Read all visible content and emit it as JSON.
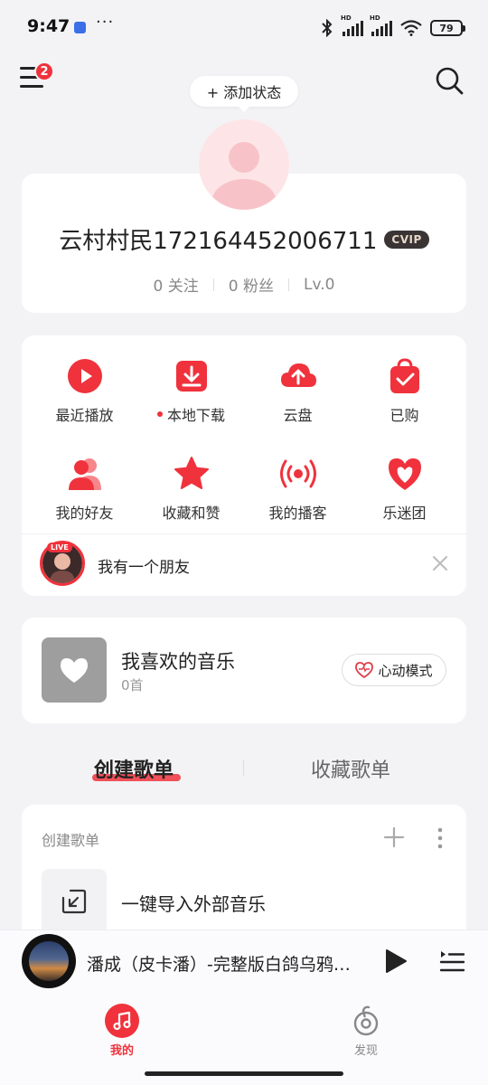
{
  "status_bar": {
    "time": "9:47",
    "more_indicator": "···",
    "battery": "79",
    "hd_label": "HD"
  },
  "header": {
    "menu_badge": "2",
    "add_status_label": "+ 添加状态"
  },
  "profile": {
    "username": "云村村民172164452006711",
    "vip_label": "CVIP",
    "stats": [
      {
        "value": "0",
        "label": "关注"
      },
      {
        "value": "0",
        "label": "粉丝"
      },
      {
        "value": "Lv.0",
        "label": ""
      }
    ]
  },
  "quick_grid": [
    {
      "label": "最近播放",
      "icon": "play-circle-icon",
      "dot": false
    },
    {
      "label": "本地下载",
      "icon": "download-icon",
      "dot": true
    },
    {
      "label": "云盘",
      "icon": "cloud-upload-icon",
      "dot": false
    },
    {
      "label": "已购",
      "icon": "shopping-bag-icon",
      "dot": false
    },
    {
      "label": "我的好友",
      "icon": "friends-icon",
      "dot": false
    },
    {
      "label": "收藏和赞",
      "icon": "star-icon",
      "dot": false
    },
    {
      "label": "我的播客",
      "icon": "broadcast-icon",
      "dot": false
    },
    {
      "label": "乐迷团",
      "icon": "fan-heart-icon",
      "dot": false
    }
  ],
  "live_banner": {
    "tag": "LIVE",
    "text": "我有一个朋友"
  },
  "liked_music": {
    "title": "我喜欢的音乐",
    "count": "0首",
    "mode_button": "心动模式"
  },
  "playlist_tabs": {
    "created": "创建歌单",
    "collected": "收藏歌单"
  },
  "playlist_section": {
    "label": "创建歌单",
    "import_text": "一键导入外部音乐"
  },
  "player": {
    "title": "潘成（皮卡潘）-完整版白鸽乌鸦相爱的戏码"
  },
  "bottom_nav": {
    "mine": "我的",
    "discover": "发现"
  },
  "colors": {
    "accent": "#f0323c",
    "background": "#f3f3f5"
  }
}
